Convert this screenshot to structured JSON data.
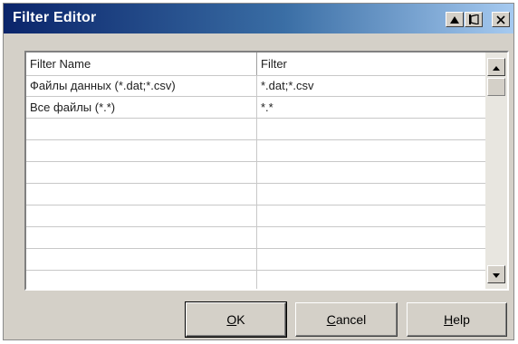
{
  "window": {
    "title": "Filter Editor",
    "buttons": {
      "up_icon": "triangle-up-icon",
      "pin_icon": "pin-icon",
      "close_icon": "close-icon"
    }
  },
  "grid": {
    "columns": [
      "Filter Name",
      "Filter"
    ],
    "rows": [
      {
        "name": "Файлы данных (*.dat;*.csv)",
        "filter": "*.dat;*.csv"
      },
      {
        "name": "Все файлы (*.*)",
        "filter": "*.*"
      },
      {
        "name": "",
        "filter": ""
      },
      {
        "name": "",
        "filter": ""
      },
      {
        "name": "",
        "filter": ""
      },
      {
        "name": "",
        "filter": ""
      },
      {
        "name": "",
        "filter": ""
      },
      {
        "name": "",
        "filter": ""
      },
      {
        "name": "",
        "filter": ""
      },
      {
        "name": "",
        "filter": ""
      }
    ]
  },
  "footer": {
    "ok_label": "OK",
    "cancel_label": "Cancel",
    "help_label": "Help"
  }
}
